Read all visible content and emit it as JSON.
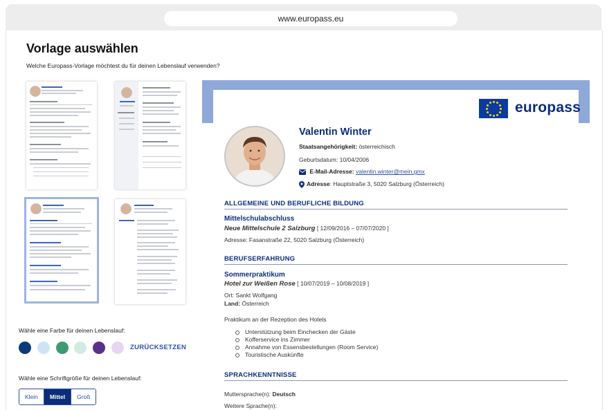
{
  "browser": {
    "url": "www.europass.eu"
  },
  "page": {
    "title": "Vorlage auswählen",
    "subtitle": "Welche Europass-Vorlage möchtest du für deinen Lebenslauf verwenden?"
  },
  "color_section": {
    "label": "Wähle eine Farbe für deinen Lebenslauf:",
    "swatches": [
      "#0d3b79",
      "#cfe3f6",
      "#3f9a74",
      "#d2ece1",
      "#5b3187",
      "#e7d6ef"
    ],
    "reset_label": "ZURÜCKSETZEN"
  },
  "font_section": {
    "label": "Wähle eine Schriftgröße für deinen Lebenslauf:",
    "options": [
      "Klein",
      "Mittel",
      "Groß"
    ],
    "selected": "Mittel"
  },
  "cv": {
    "logo_text": "europass",
    "name": "Valentin Winter",
    "nationality_label": "Staatsangehörigkeit:",
    "nationality_value": "österreichisch",
    "birth_label": "Geburtsdatum:",
    "birth_value": "10/04/2006",
    "email_label": "E-Mail-Adresse:",
    "email_value": "valentin.winter@mein.gmx",
    "address_label": "Adresse",
    "address_value": ": Hauptstraße 3, 5020 Salzburg (Österreich)",
    "edu_heading": "ALLGEMEINE UND BERUFLICHE BILDUNG",
    "edu_title": "Mittelschulabschluss",
    "edu_school": "Neue Mittelschule 2 Salzburg",
    "edu_dates": " [ 12/09/2016 – 07/07/2020 ]",
    "edu_address": "Adresse: Fasanstraße 22, 5020 Salzburg (Österreich)",
    "work_heading": "BERUFSERFAHRUNG",
    "work_title": "Sommerpraktikum",
    "work_company": "Hotel zur Weißen Rose",
    "work_dates": " [ 10/07/2019 – 10/08/2019 ]",
    "work_place_label": "Ort:",
    "work_place_value": " Sankt Wolfgang",
    "work_country_label": "Land:",
    "work_country_value": " Österreich",
    "work_desc": "Praktikum an der Rezeption des Hotels",
    "work_bullets": [
      "Unterstützung beim Einchecken der Gäste",
      "Kofferservice ins Zimmer",
      "Annahme von Essensbestellungen (Room Service)",
      "Touristische Auskünfte"
    ],
    "lang_heading": "SPRACHKENNTNISSE",
    "mother_label": "Muttersprache(n):",
    "mother_value": " Deutsch",
    "other_label": "Weitere Sprache(n):"
  }
}
